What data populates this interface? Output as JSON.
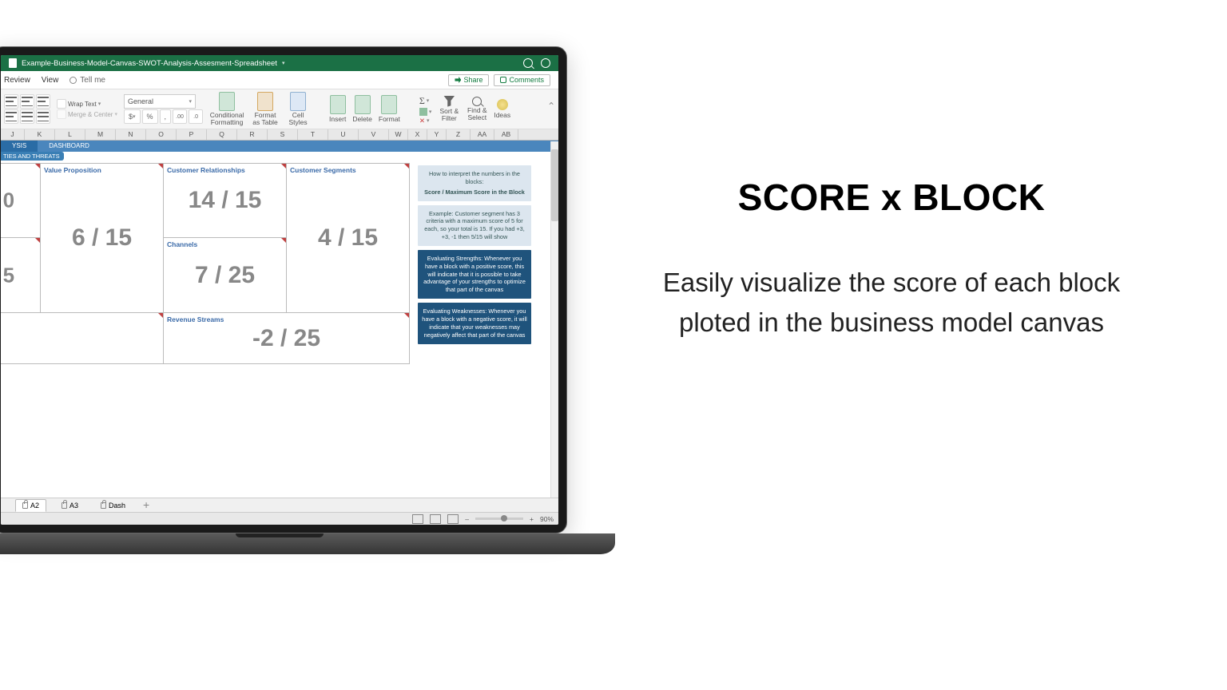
{
  "title": "Example-Business-Model-Canvas-SWOT-Analysis-Assesment-Spreadsheet",
  "menu": {
    "review": "Review",
    "view": "View",
    "tellme": "Tell me",
    "share": "Share",
    "comments": "Comments"
  },
  "toolbar": {
    "wrap": "Wrap Text",
    "merge": "Merge & Center",
    "numberFormat": "General",
    "condfmt": "Conditional Formatting",
    "astable": "Format as Table",
    "cellstyles": "Cell Styles",
    "insert": "Insert",
    "delete": "Delete",
    "format": "Format",
    "sortfilter": "Sort & Filter",
    "findselect": "Find & Select",
    "ideas": "Ideas",
    "dollar": "$",
    "percent": "%",
    "comma": ","
  },
  "columns": [
    "J",
    "K",
    "L",
    "M",
    "N",
    "O",
    "P",
    "Q",
    "R",
    "S",
    "T",
    "U",
    "V",
    "W",
    "X",
    "Y",
    "Z",
    "AA",
    "AB"
  ],
  "tabs": {
    "ysisTab": "YSIS",
    "dashboard": "DASHBOARD"
  },
  "pill": "TIES AND THREATS",
  "canvas": {
    "vp": {
      "title": "Value Proposition",
      "score": "6 / 15"
    },
    "cr": {
      "title": "Customer Relationships",
      "score": "14 / 15"
    },
    "ch": {
      "title": "Channels",
      "score": "7 / 25"
    },
    "cs": {
      "title": "Customer Segments",
      "score": "4 / 15"
    },
    "rs": {
      "title": "Revenue Streams",
      "score": "-2 / 25"
    },
    "leftTopScore": "0",
    "leftBotScore": "5"
  },
  "info": {
    "howto": "How to interpret the numbers in the blocks:",
    "howto2": "Score / Maximum Score in the Block",
    "example": "Example: Customer segment has 3 criteria with a maximum score of 5 for each, so your total is 15. If you had +3, +3, -1 then 5/15 will show",
    "strengths": "Evaluating Strengths: Whenever you have a block with a positive score, this will indicate that it is possible to take advantage of your strengths to optimize that part of the canvas",
    "weak": "Evaluating Weaknesses: Whenever you have a block with a negative score, it will indicate that your weaknesses may negatively affect that part of the canvas"
  },
  "sheets": {
    "s1": "A2",
    "s2": "A3",
    "s3": "Dash",
    "add": "+"
  },
  "status": {
    "zoom": "90%",
    "minus": "–",
    "plus": "+"
  },
  "marketing": {
    "title": "SCORE x BLOCK",
    "body": "Easily visualize the score of each block ploted in the business model canvas"
  }
}
